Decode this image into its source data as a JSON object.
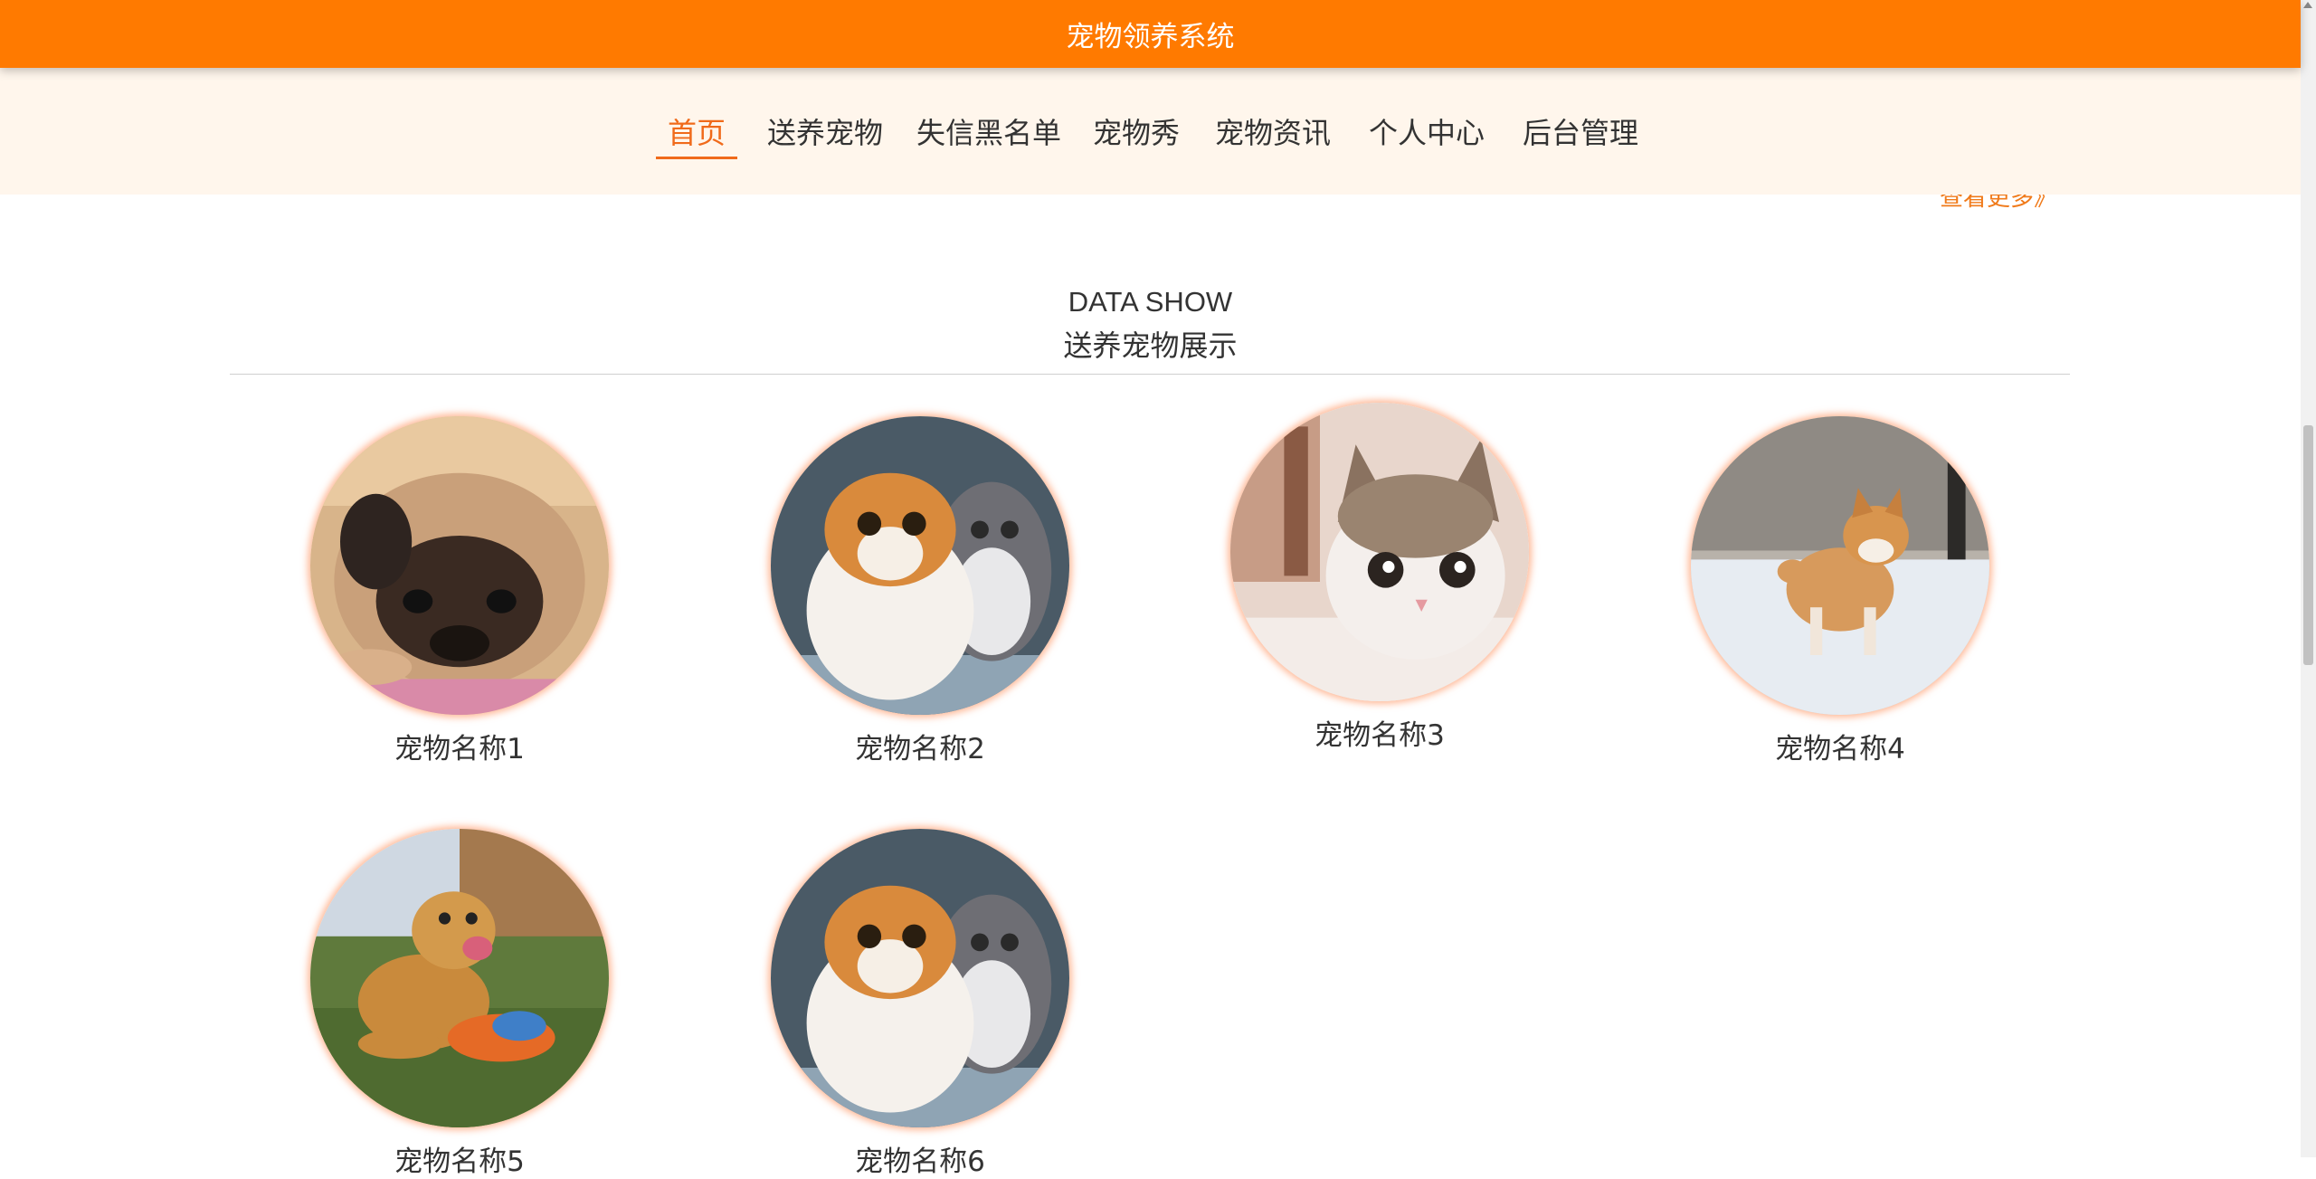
{
  "header": {
    "title": "宠物领养系统"
  },
  "nav": {
    "items": [
      {
        "label": "首页",
        "active": true
      },
      {
        "label": "送养宠物",
        "active": false
      },
      {
        "label": "失信黑名单",
        "active": false
      },
      {
        "label": "宠物秀",
        "active": false
      },
      {
        "label": "宠物资讯",
        "active": false
      },
      {
        "label": "个人中心",
        "active": false
      },
      {
        "label": "后台管理",
        "active": false
      }
    ]
  },
  "more_link": "查看更多》",
  "section": {
    "title_en": "DATA SHOW",
    "title_zh": "送养宠物展示"
  },
  "pets": [
    {
      "name": "宠物名称1",
      "image": "pug-photo"
    },
    {
      "name": "宠物名称2",
      "image": "exotic-cats-photo"
    },
    {
      "name": "宠物名称3",
      "image": "kitten-photo"
    },
    {
      "name": "宠物名称4",
      "image": "shiba-puppy-photo"
    },
    {
      "name": "宠物名称5",
      "image": "golden-retriever-photo"
    },
    {
      "name": "宠物名称6",
      "image": "exotic-cats-photo"
    }
  ],
  "colors": {
    "brand": "#ff7a00",
    "nav_background": "#fff6ec",
    "active": "#f06a1a"
  }
}
